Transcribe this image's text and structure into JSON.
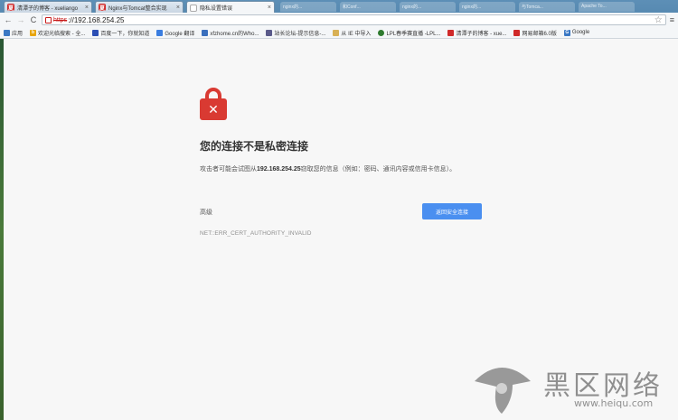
{
  "tabs": [
    {
      "title": "清潭子的博客 - xueliango",
      "active": false,
      "close": "×",
      "favicon_color": "#d02a2a"
    },
    {
      "title": "Nginx与Tomcat整合实现",
      "active": false,
      "close": "×",
      "favicon_color": "#d02a2a"
    },
    {
      "title": "隐私设置错误",
      "active": true,
      "close": "×",
      "favicon_color": "#aaaaaa"
    }
  ],
  "ghost_tabs": [
    "nginx的...",
    "和Conf...",
    "nginx的...",
    "nginx的...",
    "与Tomca...",
    "Apache To..."
  ],
  "toolbar": {
    "back": "←",
    "forward": "→",
    "reload": "C",
    "https_label": "https",
    "url": "://192.168.254.25",
    "star": "☆",
    "menu": "≡"
  },
  "bookmarks": [
    {
      "icon_color": "#3a78c4",
      "icon": "",
      "label": "应用"
    },
    {
      "icon_color": "#e8a50c",
      "icon": "b",
      "label": "欢迎光临搜索 - 全..."
    },
    {
      "icon_color": "#2c4fb5",
      "icon": "",
      "label": "百度一下，你就知道"
    },
    {
      "icon_color": "#3a7de0",
      "icon": "",
      "label": "Google 翻译"
    },
    {
      "icon_color": "#3a6fbd",
      "icon": "",
      "label": "xfzhome.cn的Who..."
    },
    {
      "icon_color": "#5a5a8a",
      "icon": "",
      "label": "站长论坛-提示信息-..."
    },
    {
      "icon_color": "#d8b055",
      "icon": "",
      "label": "从 IE 中导入"
    },
    {
      "icon_color": "#2e7a2e",
      "icon": "",
      "label": "LPL春季赛直播 -LPL..."
    },
    {
      "icon_color": "#d02a2a",
      "icon": "",
      "label": "清潭子的博客 - xue..."
    },
    {
      "icon_color": "#d02a2a",
      "icon": "",
      "label": "网易邮箱6.0版"
    },
    {
      "icon_color": "#3a78c4",
      "icon": "G",
      "label": "Google"
    }
  ],
  "page": {
    "heading": "您的连接不是私密连接",
    "desc_before": "攻击者可能会试图从",
    "desc_host": "192.168.254.25",
    "desc_after": "窃取您的信息（例如：密码、通讯内容或信用卡信息）。",
    "advanced": "高级",
    "back_button": "返回安全连接",
    "error_code": "NET::ERR_CERT_AUTHORITY_INVALID",
    "accent_color": "#4a8ff0",
    "lock_color": "#d93a32"
  },
  "watermark": {
    "text": "黑区网络",
    "url": "www.heiqu.com"
  }
}
